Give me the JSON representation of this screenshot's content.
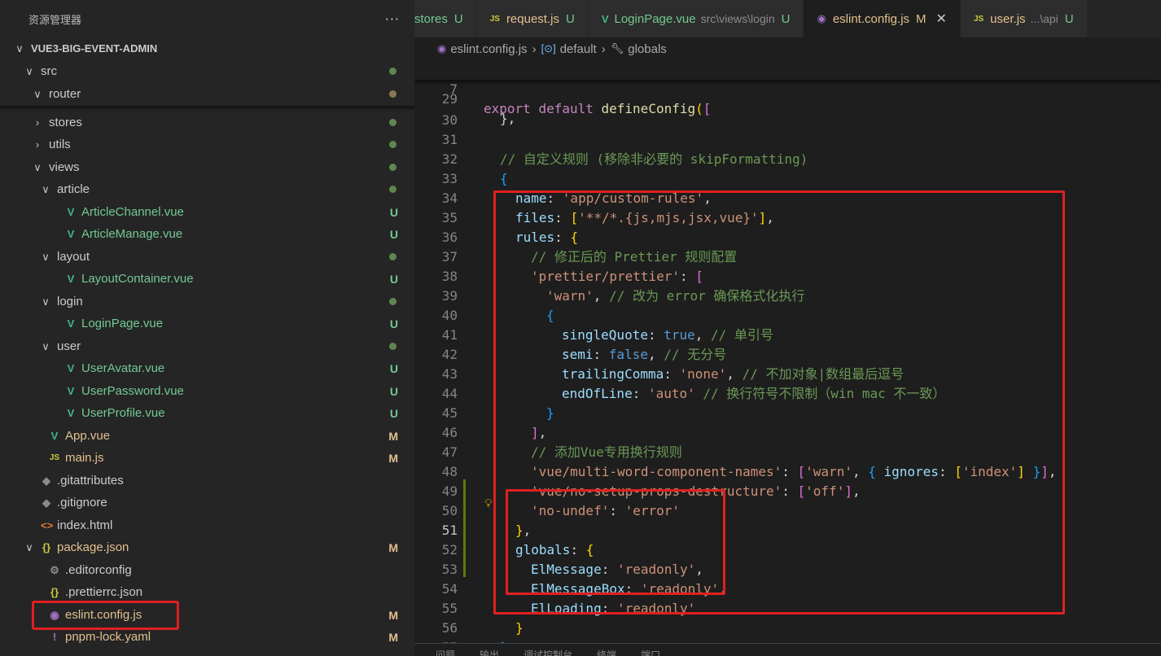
{
  "sidebar": {
    "title": "资源管理器",
    "more": "···",
    "tree": [
      {
        "label": "VUE3-BIG-EVENT-ADMIN",
        "type": "root",
        "chev": "∨"
      },
      {
        "label": "src",
        "type": "folder",
        "chev": "∨",
        "status": "dot"
      },
      {
        "label": "router",
        "type": "folder",
        "chev": "∨",
        "status": "dot-brown"
      },
      {
        "label": "stores",
        "type": "folder",
        "chev": "›",
        "status": "dot"
      },
      {
        "label": "utils",
        "type": "folder",
        "chev": "›",
        "status": "dot"
      },
      {
        "label": "views",
        "type": "folder",
        "chev": "∨",
        "status": "dot"
      },
      {
        "label": "article",
        "type": "folder",
        "chev": "∨",
        "status": "dot"
      },
      {
        "label": "ArticleChannel.vue",
        "type": "vue",
        "status": "U"
      },
      {
        "label": "ArticleManage.vue",
        "type": "vue",
        "status": "U"
      },
      {
        "label": "layout",
        "type": "folder",
        "chev": "∨",
        "status": "dot"
      },
      {
        "label": "LayoutContainer.vue",
        "type": "vue",
        "status": "U"
      },
      {
        "label": "login",
        "type": "folder",
        "chev": "∨",
        "status": "dot"
      },
      {
        "label": "LoginPage.vue",
        "type": "vue",
        "status": "U"
      },
      {
        "label": "user",
        "type": "folder",
        "chev": "∨",
        "status": "dot"
      },
      {
        "label": "UserAvatar.vue",
        "type": "vue",
        "status": "U"
      },
      {
        "label": "UserPassword.vue",
        "type": "vue",
        "status": "U"
      },
      {
        "label": "UserProfile.vue",
        "type": "vue",
        "status": "U"
      },
      {
        "label": "App.vue",
        "type": "vue",
        "status": "M"
      },
      {
        "label": "main.js",
        "type": "js",
        "status": "M"
      },
      {
        "label": ".gitattributes",
        "type": "git"
      },
      {
        "label": ".gitignore",
        "type": "git"
      },
      {
        "label": "index.html",
        "type": "html"
      },
      {
        "label": "package.json",
        "type": "json",
        "chev": "∨",
        "status": "M"
      },
      {
        "label": ".editorconfig",
        "type": "gear"
      },
      {
        "label": ".prettierrc.json",
        "type": "json"
      },
      {
        "label": "eslint.config.js",
        "type": "eslint",
        "status": "M"
      },
      {
        "label": "pnpm-lock.yaml",
        "type": "yaml",
        "status": "M"
      }
    ]
  },
  "tabs": [
    {
      "icon": "",
      "name": "stores",
      "status": "U",
      "cls": "g"
    },
    {
      "icon": "JS",
      "name": "request.js",
      "status": "U",
      "cls": ""
    },
    {
      "icon": "V",
      "name": "LoginPage.vue",
      "desc": "src\\views\\login",
      "status": "U",
      "cls": "g"
    },
    {
      "icon": "◉",
      "name": "eslint.config.js",
      "status": "M",
      "cls": "",
      "close": "✕"
    },
    {
      "icon": "JS",
      "name": "user.js",
      "desc": "...\\api",
      "status": "U",
      "cls": ""
    }
  ],
  "breadcrumb": {
    "file": "eslint.config.js",
    "item2": "default",
    "item3": "globals",
    "sep": "›"
  },
  "code": {
    "sticky_line_num": "7",
    "line_29_fragment": "},",
    "comment_31": "// 自定义规则 (移除非必要的 skipFormatting)",
    "name_key": "name",
    "name_val": "'app/custom-rules'",
    "files_key": "files",
    "files_val": "'**/*.{js,mjs,jsx,vue}'",
    "rules_key": "rules",
    "comment_36": "// 修正后的 Prettier 规则配置",
    "prettier_rule": "'prettier/prettier'",
    "warn_val": "'warn'",
    "comment_38": "// 改为 error 确保格式化执行",
    "singleQuote": "singleQuote",
    "true_val": "true",
    "comment_40": "// 单引号",
    "semi": "semi",
    "false_val": "false",
    "comment_41": "// 无分号",
    "trailingComma": "trailingComma",
    "none_val": "'none'",
    "comment_42": "// 不加对象|数组最后逗号",
    "endOfLine": "endOfLine",
    "auto_val": "'auto'",
    "comment_43": "// 换行符号不限制（win mac 不一致）",
    "comment_46": "// 添加Vue专用换行规则",
    "rule_mwcn": "'vue/multi-word-component-names'",
    "ignores_key": "ignores",
    "index_val": "'index'",
    "rule_nspd": "'vue/no-setup-props-destructure'",
    "off_val": "'off'",
    "rule_noundef": "'no-undef'",
    "error_val": "'error'",
    "globals_key": "globals",
    "elmessage": "ElMessage",
    "elmessagebox": "ElMessageBox",
    "elloading": "ElLoading",
    "readonly_val": "'readonly'"
  },
  "panel": [
    "问题",
    "输出",
    "调试控制台",
    "终端",
    "端口"
  ]
}
